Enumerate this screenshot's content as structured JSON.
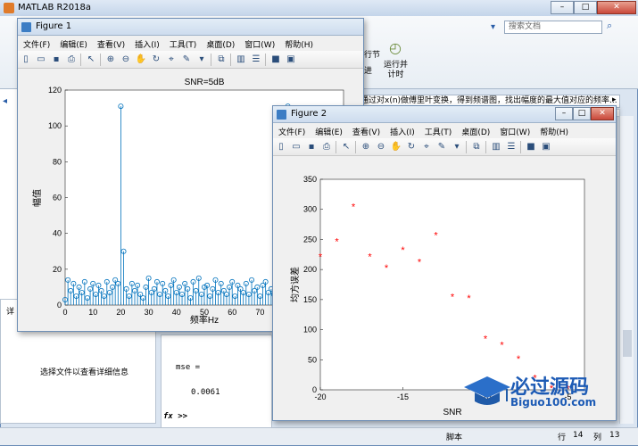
{
  "matlab": {
    "title": "MATLAB R2018a",
    "window_controls": {
      "minimize": "–",
      "maximize": "□",
      "close": "✕"
    },
    "search_placeholder": "搜索文档",
    "ribbon": {
      "run_section_label": "行节",
      "advance_label": "进",
      "run_and_time_label": "运行并\n计时"
    },
    "editor_comment": "通过对x(n)做傅里叶变换，得到频谱图，找出幅度的最大值对应的频率...",
    "left_panel_text": "选择文件以查看详细信息",
    "left_tab_label": "详",
    "command_window": {
      "line1": "mse =",
      "line2": "0.0061",
      "prompt": "fx >>"
    },
    "status": {
      "script_label": "脚本",
      "row_label": "行",
      "row_value": "14",
      "col_label": "列",
      "col_value": "13"
    }
  },
  "figure1": {
    "title": "Figure 1",
    "menu": [
      "文件(F)",
      "编辑(E)",
      "查看(V)",
      "插入(I)",
      "工具(T)",
      "桌面(D)",
      "窗口(W)",
      "帮助(H)"
    ]
  },
  "figure2": {
    "title": "Figure 2",
    "menu": [
      "文件(F)",
      "编辑(E)",
      "查看(V)",
      "插入(I)",
      "工具(T)",
      "桌面(D)",
      "窗口(W)",
      "帮助(H)"
    ]
  },
  "chart_data": [
    {
      "type": "stem",
      "title": "SNR=5dB",
      "xlabel": "频率Hz",
      "ylabel": "幅值",
      "xlim": [
        0,
        100
      ],
      "ylim": [
        0,
        120
      ],
      "xticks": [
        0,
        10,
        20,
        30,
        40,
        50,
        60,
        70,
        80,
        90,
        100
      ],
      "yticks": [
        0,
        20,
        40,
        60,
        80,
        100,
        120
      ],
      "color": "#0072bd",
      "x": [
        0,
        1,
        2,
        3,
        4,
        5,
        6,
        7,
        8,
        9,
        10,
        11,
        12,
        13,
        14,
        15,
        16,
        17,
        18,
        19,
        20,
        21,
        22,
        23,
        24,
        25,
        26,
        27,
        28,
        29,
        30,
        31,
        32,
        33,
        34,
        35,
        36,
        37,
        38,
        39,
        40,
        41,
        42,
        43,
        44,
        45,
        46,
        47,
        48,
        49,
        50,
        51,
        52,
        53,
        54,
        55,
        56,
        57,
        58,
        59,
        60,
        61,
        62,
        63,
        64,
        65,
        66,
        67,
        68,
        69,
        70,
        71,
        72,
        73,
        74,
        75,
        76,
        77,
        78,
        79,
        80
      ],
      "values": [
        3,
        14,
        8,
        12,
        5,
        10,
        7,
        13,
        4,
        9,
        12,
        6,
        11,
        8,
        5,
        13,
        7,
        10,
        14,
        12,
        111,
        30,
        9,
        5,
        12,
        8,
        11,
        6,
        4,
        10,
        15,
        7,
        9,
        13,
        6,
        12,
        8,
        5,
        11,
        14,
        7,
        10,
        6,
        12,
        9,
        4,
        13,
        8,
        15,
        6,
        10,
        11,
        5,
        9,
        14,
        7,
        12,
        8,
        6,
        10,
        13,
        5,
        11,
        9,
        7,
        12,
        6,
        14,
        8,
        10,
        5,
        11,
        13,
        7,
        9,
        6,
        12,
        8,
        10,
        5,
        111
      ]
    },
    {
      "type": "scatter",
      "xlabel": "SNR",
      "ylabel": "均方误差",
      "xlim": [
        -20,
        -4
      ],
      "ylim": [
        0,
        350
      ],
      "xticks": [
        -20,
        -15,
        -10,
        -5
      ],
      "yticks": [
        0,
        50,
        100,
        150,
        200,
        250,
        300,
        350
      ],
      "color": "#ff0000",
      "marker": "*",
      "x": [
        -20,
        -19,
        -18,
        -17,
        -16,
        -15,
        -14,
        -13,
        -12,
        -11,
        -10,
        -9,
        -8,
        -7,
        -6,
        -5
      ],
      "values": [
        222,
        247,
        305,
        222,
        203,
        233,
        213,
        257,
        155,
        153,
        85,
        75,
        52,
        20,
        3,
        2
      ]
    }
  ],
  "watermark": {
    "text": "必过源码",
    "url_text": "Biguo100.com"
  }
}
